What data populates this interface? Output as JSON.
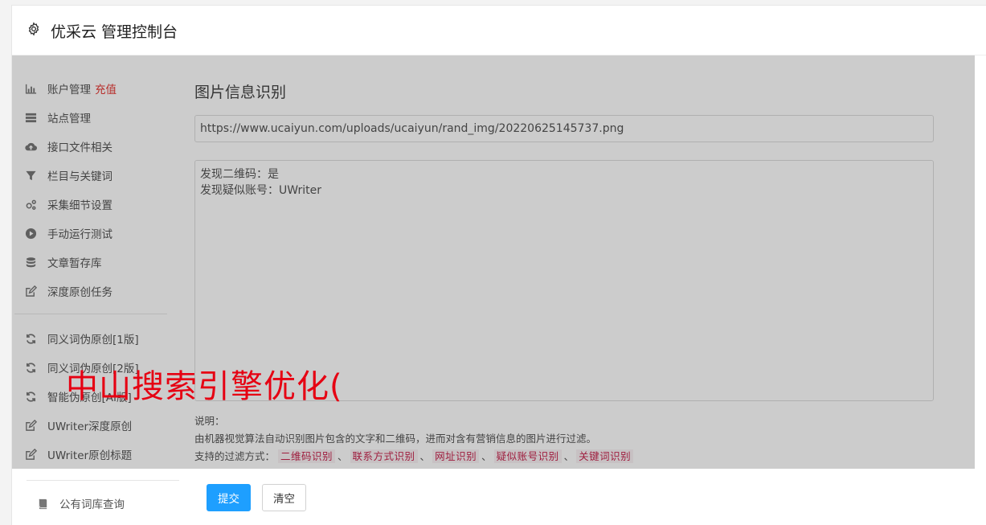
{
  "header": {
    "title": "优采云 管理控制台",
    "icon": "gear-icon"
  },
  "sidebar": {
    "group1": [
      {
        "label": "账户管理",
        "extra": "充值",
        "icon": "bar-chart-icon"
      },
      {
        "label": "站点管理",
        "icon": "server-icon"
      },
      {
        "label": "接口文件相关",
        "icon": "cloud-upload-icon"
      },
      {
        "label": "栏目与关键词",
        "icon": "filter-icon"
      },
      {
        "label": "采集细节设置",
        "icon": "cogs-icon"
      },
      {
        "label": "手动运行测试",
        "icon": "play-circle-icon"
      },
      {
        "label": "文章暂存库",
        "icon": "database-icon"
      },
      {
        "label": "深度原创任务",
        "icon": "edit-icon"
      }
    ],
    "group2": [
      {
        "label": "同义词伪原创[1版]",
        "icon": "refresh-icon"
      },
      {
        "label": "同义词伪原创[2版]",
        "icon": "refresh-icon"
      },
      {
        "label": "智能伪原创[AI版]",
        "icon": "refresh-icon"
      },
      {
        "label": "UWriter深度原创",
        "icon": "edit-icon"
      },
      {
        "label": "UWriter原创标题",
        "icon": "edit-icon"
      }
    ],
    "group3": [
      {
        "label": "公有词库查询",
        "icon": "book-icon"
      }
    ]
  },
  "main": {
    "title": "图片信息识别",
    "url_value": "https://www.ucaiyun.com/uploads/ucaiyun/rand_img/20220625145737.png",
    "result_lines": [
      "发现二维码：是",
      "发现疑似账号：UWriter"
    ],
    "desc_label": "说明：",
    "desc_text": "由机器视觉算法自动识别图片包含的文字和二维码，进而对含有营销信息的图片进行过滤。",
    "filter_label": "支持的过滤方式：",
    "filter_tags": [
      "二维码识别",
      "联系方式识别",
      "网址识别",
      "疑似账号识别",
      "关键词识别"
    ],
    "filter_sep": "、"
  },
  "buttons": {
    "submit": "提交",
    "clear": "清空"
  },
  "watermark": "中山搜索引擎优化(",
  "colors": {
    "primary": "#1e9fff",
    "accent_red": "#e53935",
    "tag_red": "#c7254e",
    "watermark_red": "#e60012"
  }
}
